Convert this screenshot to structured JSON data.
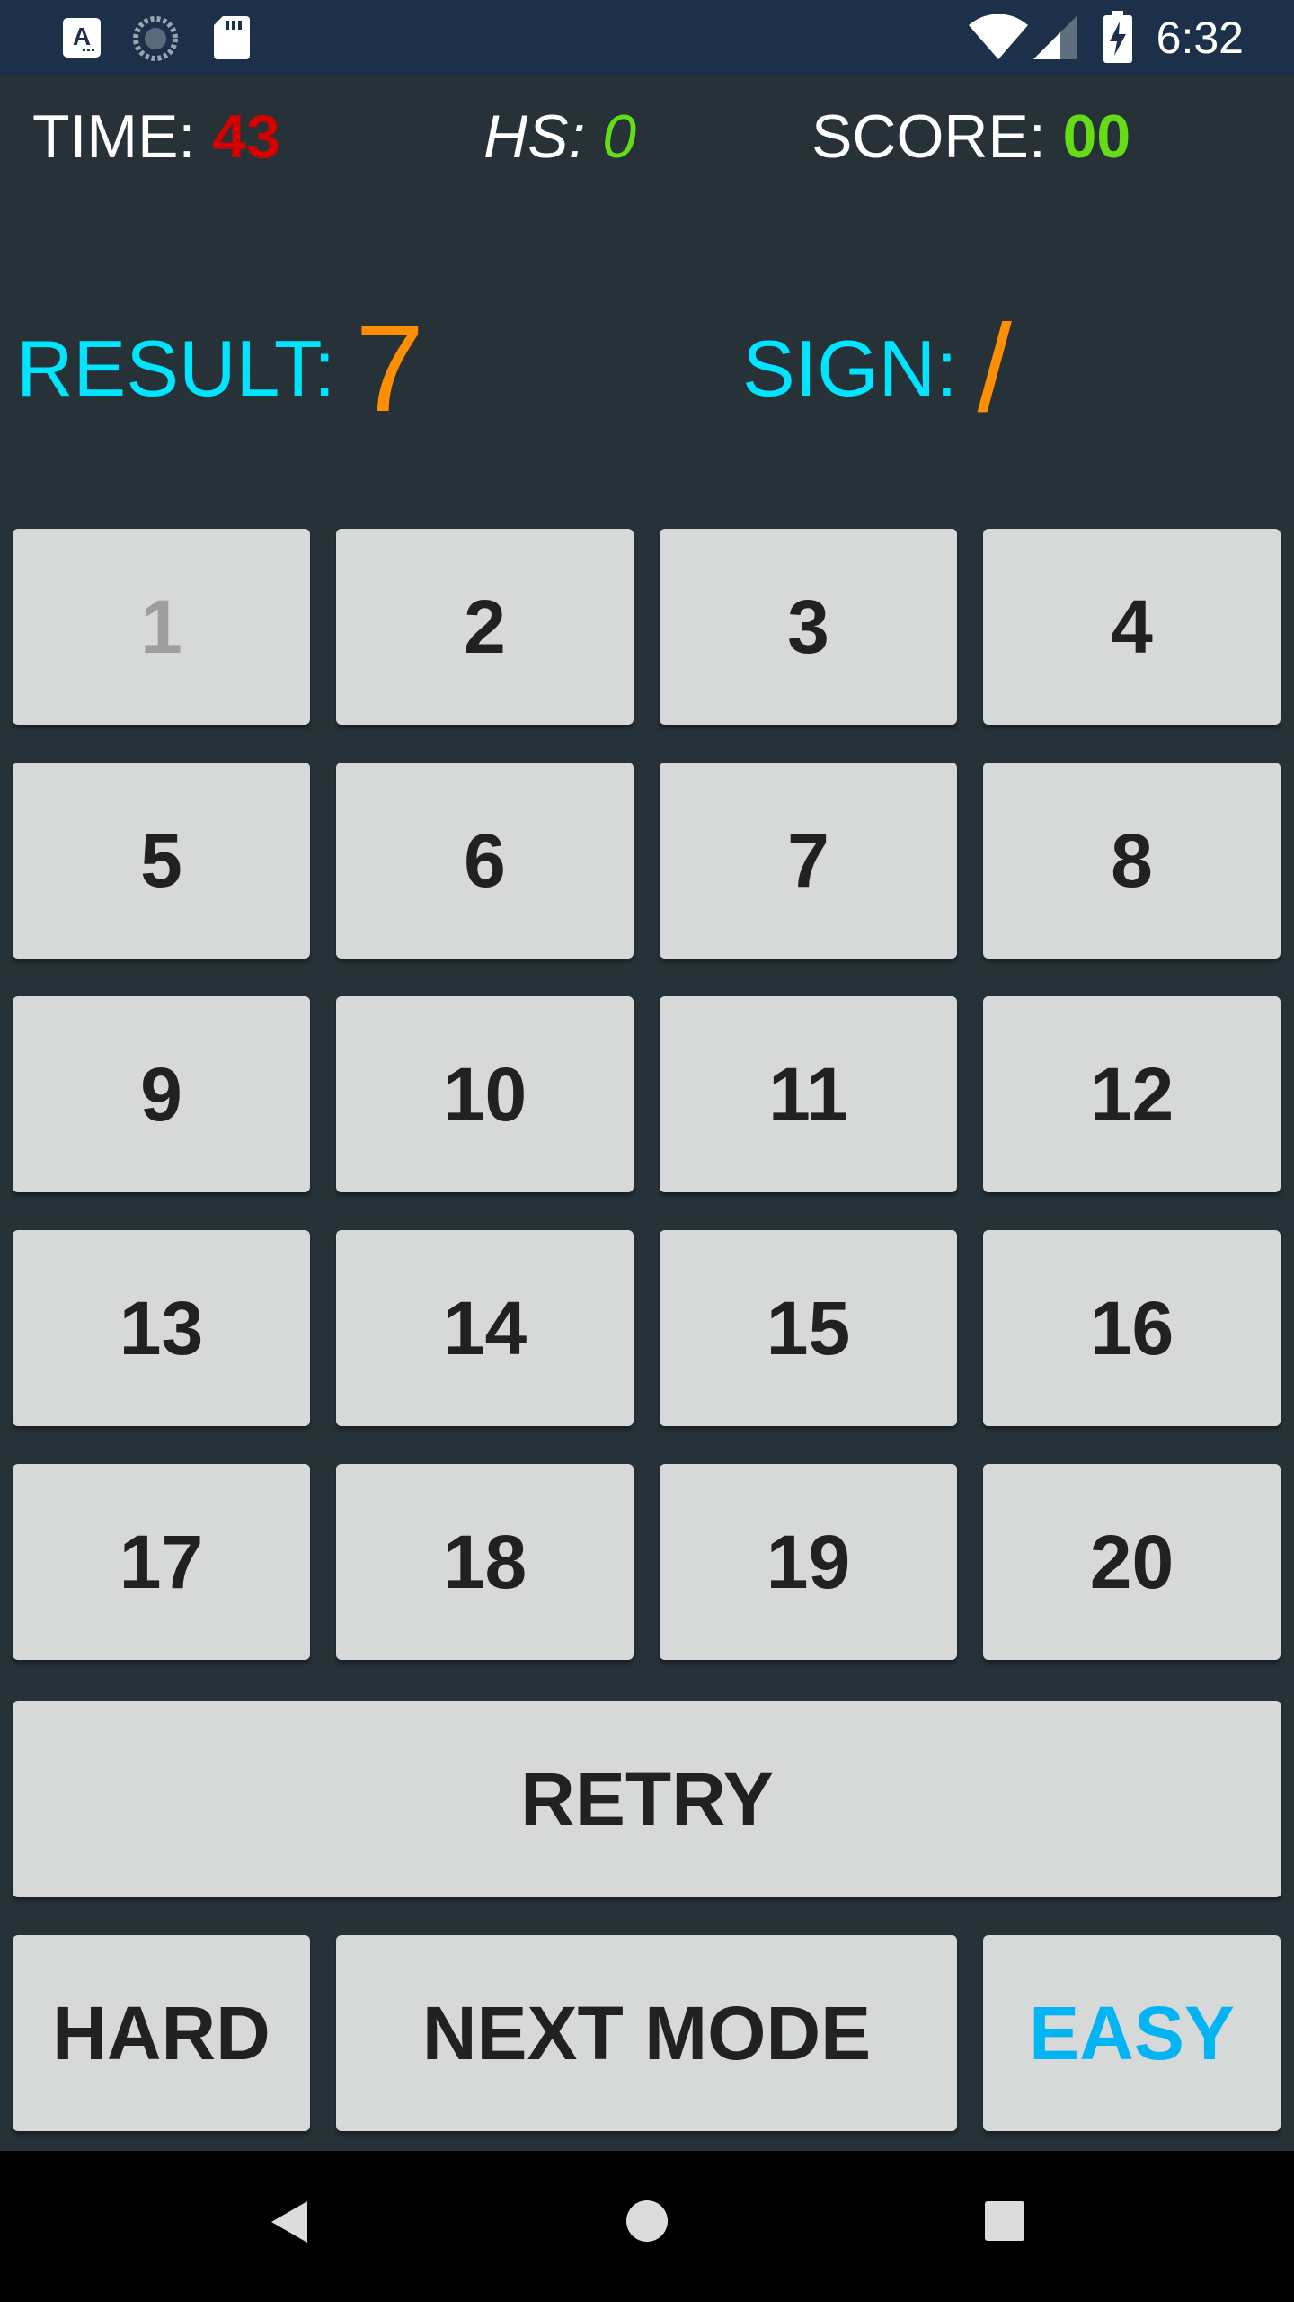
{
  "status_bar": {
    "time": "6:32",
    "icons": [
      "app-a-icon",
      "sync-icon",
      "sd-card-icon",
      "wifi-icon",
      "signal-icon",
      "battery-charging-icon"
    ]
  },
  "stats": {
    "time_label": "TIME: ",
    "time_value": "43",
    "hs_label": "HS: ",
    "hs_value": "0",
    "score_label": "SCORE: ",
    "score_value": "00"
  },
  "puzzle": {
    "result_label": "RESULT:",
    "result_value": "7",
    "sign_label": "SIGN:",
    "sign_value": "/"
  },
  "keys": [
    "1",
    "2",
    "3",
    "4",
    "5",
    "6",
    "7",
    "8",
    "9",
    "10",
    "11",
    "12",
    "13",
    "14",
    "15",
    "16",
    "17",
    "18",
    "19",
    "20"
  ],
  "controls": {
    "retry_label": "RETRY",
    "hard_label": "HARD",
    "next_mode_label": "NEXT MODE",
    "easy_label": "EASY"
  },
  "colors": {
    "background": "#263238",
    "status_bar": "#1c3049",
    "time_value": "#d50000",
    "score_value": "#64dd17",
    "label_cyan": "#00e5ff",
    "value_orange": "#ff8f00",
    "button_bg": "#d7d8d8",
    "easy_selected": "#03b4f5",
    "disabled_text": "#9e9e9e"
  },
  "nav_bar": {
    "buttons": [
      "back-icon",
      "home-icon",
      "recents-icon"
    ]
  }
}
